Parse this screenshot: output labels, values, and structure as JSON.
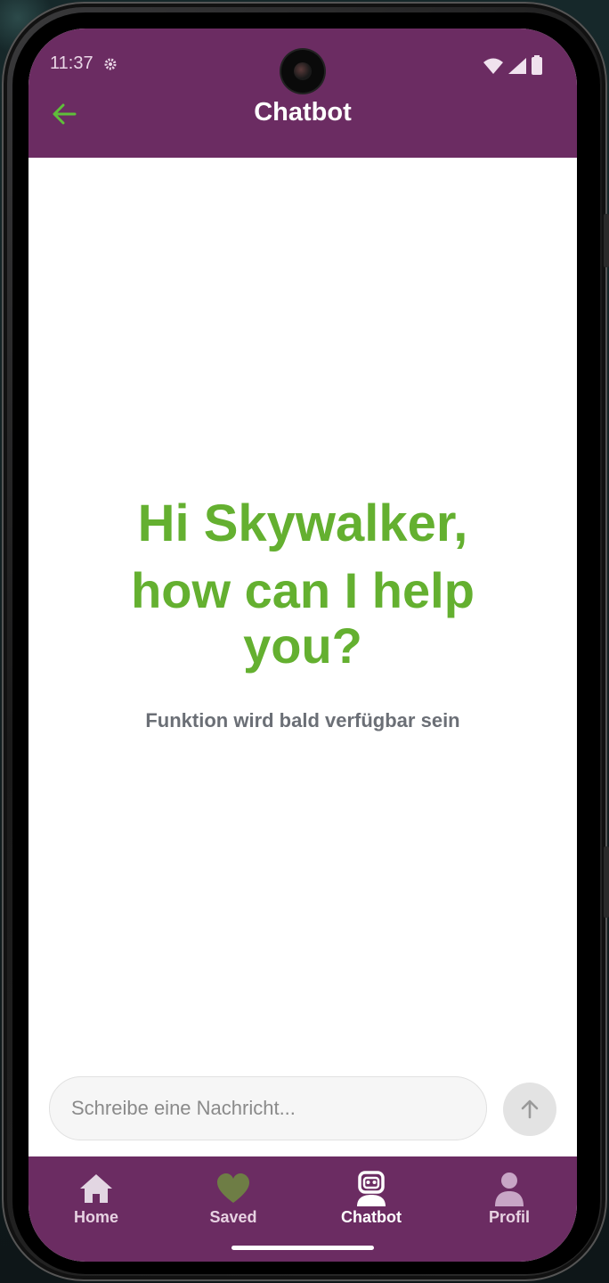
{
  "status_bar": {
    "time": "11:37"
  },
  "header": {
    "title": "Chatbot",
    "back_icon": "arrow-left-icon",
    "background_color": "#6b2c62",
    "back_icon_color": "#5fbf3a"
  },
  "main": {
    "greeting_line1": "Hi Skywalker,",
    "greeting_line2": "how can I help you?",
    "subtext": "Funktion wird bald verfügbar sein",
    "greeting_color": "#64b030"
  },
  "composer": {
    "placeholder": "Schreibe eine Nachricht...",
    "send_icon": "arrow-up-icon"
  },
  "bottom_nav": {
    "items": [
      {
        "label": "Home",
        "icon": "home-icon",
        "active": false
      },
      {
        "label": "Saved",
        "icon": "heart-icon",
        "active": false
      },
      {
        "label": "Chatbot",
        "icon": "robot-icon",
        "active": true
      },
      {
        "label": "Profil",
        "icon": "person-icon",
        "active": false
      }
    ]
  }
}
